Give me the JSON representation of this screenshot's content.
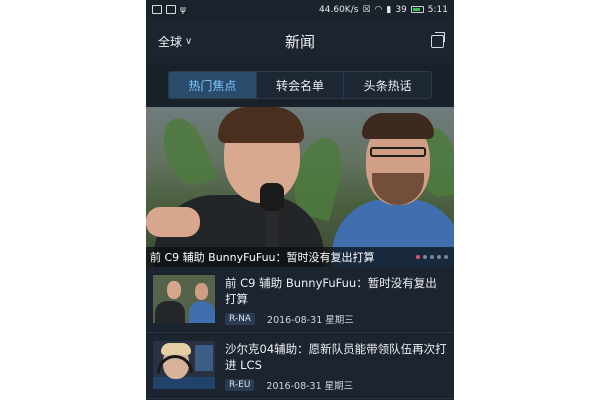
{
  "status_bar": {
    "speed": "44.60K/s",
    "signal": "39",
    "time": "5:11"
  },
  "nav": {
    "region_label": "全球",
    "title": "新闻"
  },
  "tabs": [
    {
      "label": "热门焦点",
      "active": true
    },
    {
      "label": "转会名单",
      "active": false
    },
    {
      "label": "头条热话",
      "active": false
    }
  ],
  "hero": {
    "caption": "前 C9 辅助 BunnyFuFuu：暂时没有复出打算",
    "slide_count": 5,
    "active_slide": 0
  },
  "news": [
    {
      "headline": "前 C9 辅助 BunnyFuFuu：暂时没有复出打算",
      "tag": "R-NA",
      "date": "2016-08-31 星期三"
    },
    {
      "headline": "沙尔克04辅助：愿新队员能带领队伍再次打进 LCS",
      "tag": "R-EU",
      "date": "2016-08-31 星期三"
    }
  ],
  "colors": {
    "background": "#1c2430",
    "tab_active": "#2a4b6b",
    "tab_active_text": "#7ec8ff",
    "dot_active": "#d8567a",
    "battery": "#39c05a"
  }
}
